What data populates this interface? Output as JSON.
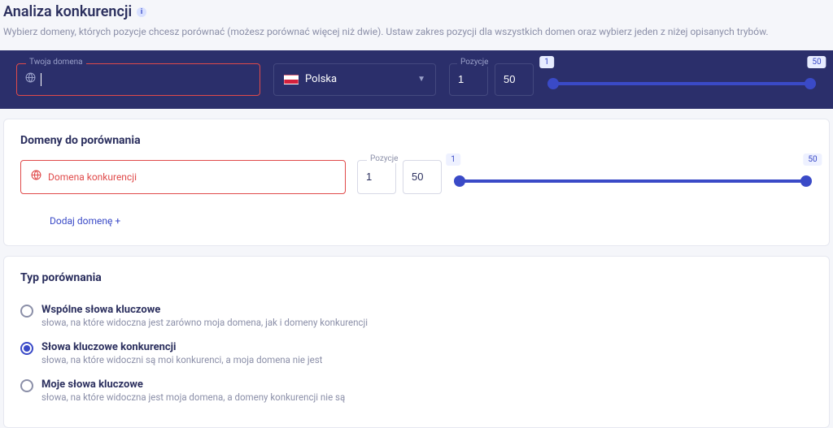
{
  "header": {
    "title": "Analiza konkurencji",
    "subtitle": "Wybierz domeny, których pozycje chcesz porównać (możesz porównać więcej niż dwie). Ustaw zakres pozycji dla wszystkich domen oraz wybierz jeden z niżej opisanych trybów."
  },
  "darkbar": {
    "domain_label": "Twoja domena",
    "domain_value": "",
    "country_selected": "Polska",
    "positions_label": "Pozycje",
    "pos_from": "1",
    "pos_to": "50",
    "slider_min": "1",
    "slider_max": "50"
  },
  "compare": {
    "heading": "Domeny do porównania",
    "placeholder": "Domena konkurencji",
    "positions_label": "Pozycje",
    "pos_from": "1",
    "pos_to": "50",
    "slider_min": "1",
    "slider_max": "50",
    "add_link": "Dodaj domenę +"
  },
  "type": {
    "heading": "Typ porównania",
    "options": [
      {
        "title": "Wspólne słowa kluczowe",
        "desc": "słowa, na które widoczna jest zarówno moja domena, jak i domeny konkurencji",
        "selected": false
      },
      {
        "title": "Słowa kluczowe konkurencji",
        "desc": "słowa, na które widoczni są moi konkurenci, a moja domena nie jest",
        "selected": true
      },
      {
        "title": "Moje słowa kluczowe",
        "desc": "słowa, na które widoczna jest moja domena, a domeny konkurencji nie są",
        "selected": false
      }
    ]
  }
}
